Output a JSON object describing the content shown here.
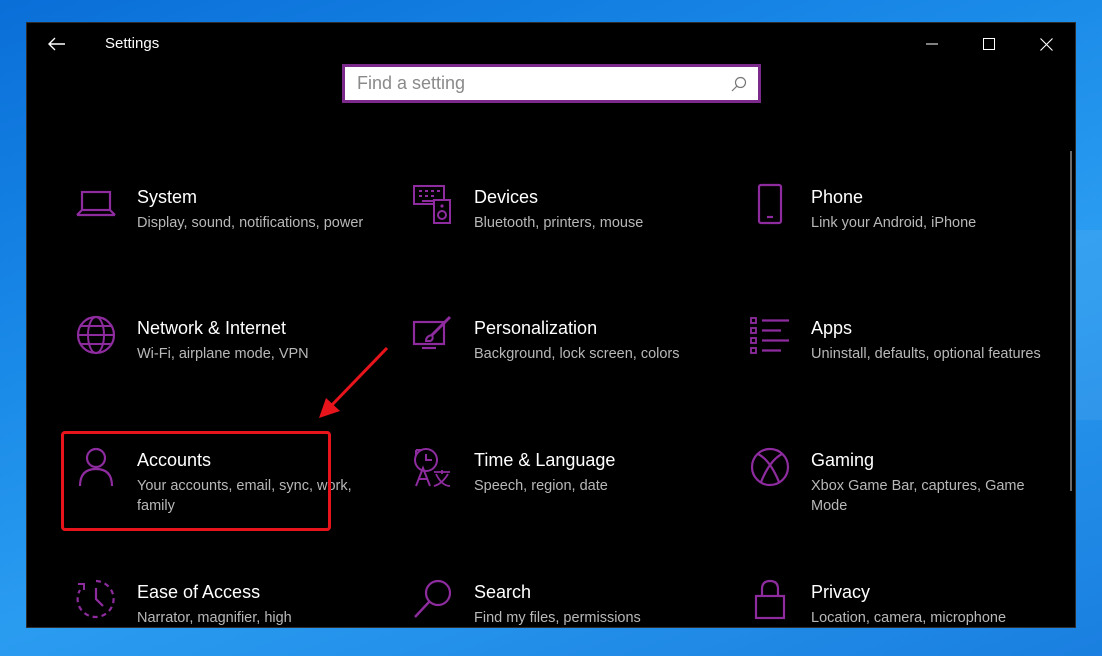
{
  "window": {
    "title": "Settings",
    "accent_color": "#7b2a8c",
    "icon_color": "#8e2c9f",
    "highlight_color": "#e8141c"
  },
  "controls": {
    "back": "back-arrow-icon",
    "minimize": "minimize-icon",
    "maximize": "maximize-icon",
    "close": "close-icon"
  },
  "search": {
    "placeholder": "Find a setting",
    "value": ""
  },
  "categories": [
    {
      "name": "System",
      "desc": "Display, sound, notifications, power",
      "icon": "laptop-icon"
    },
    {
      "name": "Devices",
      "desc": "Bluetooth, printers, mouse",
      "icon": "keyboard-speaker-icon"
    },
    {
      "name": "Phone",
      "desc": "Link your Android, iPhone",
      "icon": "phone-icon"
    },
    {
      "name": "Network & Internet",
      "desc": "Wi-Fi, airplane mode, VPN",
      "icon": "globe-icon"
    },
    {
      "name": "Personalization",
      "desc": "Background, lock screen, colors",
      "icon": "paintbrush-icon"
    },
    {
      "name": "Apps",
      "desc": "Uninstall, defaults, optional features",
      "icon": "apps-list-icon"
    },
    {
      "name": "Accounts",
      "desc": "Your accounts, email, sync, work, family",
      "icon": "person-icon"
    },
    {
      "name": "Time & Language",
      "desc": "Speech, region, date",
      "icon": "time-language-icon"
    },
    {
      "name": "Gaming",
      "desc": "Xbox Game Bar, captures, Game Mode",
      "icon": "xbox-icon"
    },
    {
      "name": "Ease of Access",
      "desc": "Narrator, magnifier, high",
      "icon": "ease-of-access-icon"
    },
    {
      "name": "Search",
      "desc": "Find my files, permissions",
      "icon": "magnifier-icon"
    },
    {
      "name": "Privacy",
      "desc": "Location, camera, microphone",
      "icon": "lock-icon"
    }
  ]
}
